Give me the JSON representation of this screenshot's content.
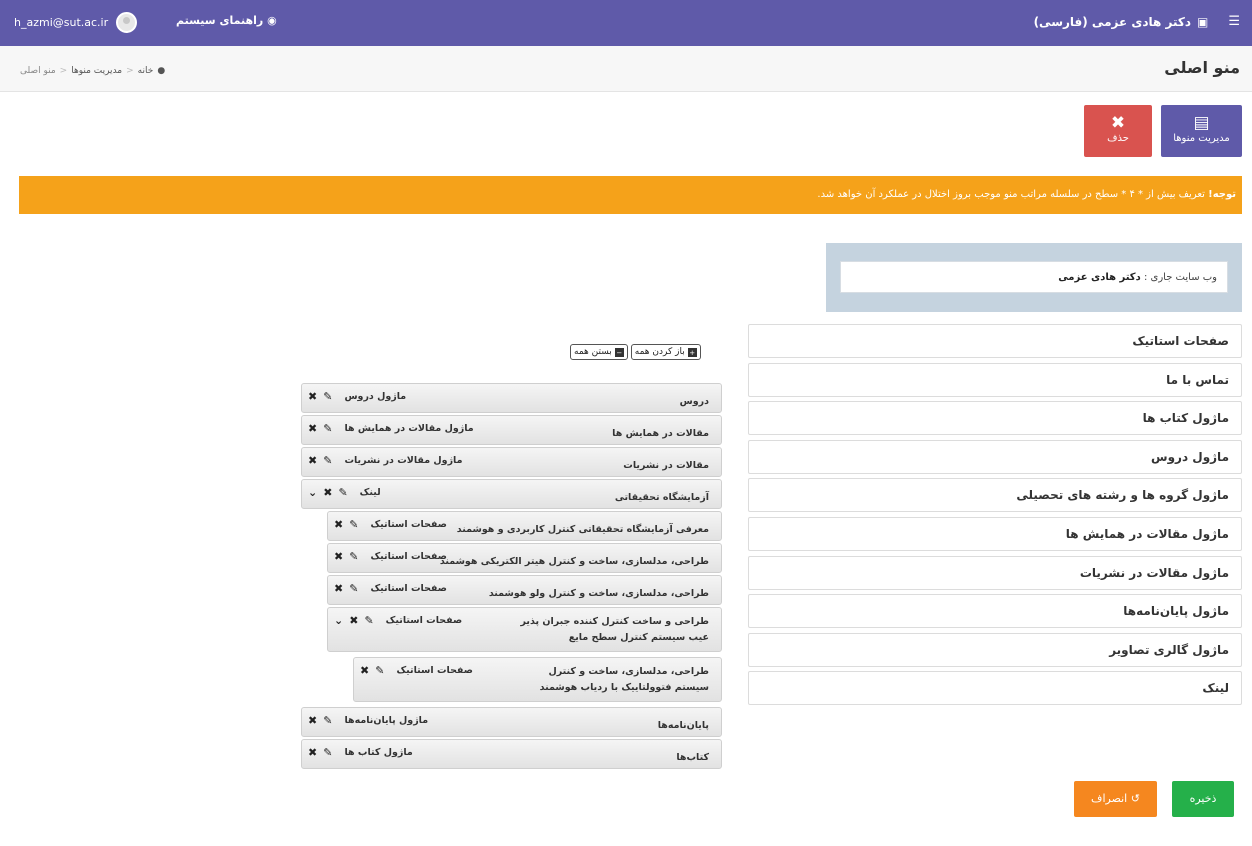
{
  "topbar": {
    "site_title": "دکتر هادی عزمی (فارسی)",
    "help_label": "راهنمای سیستم",
    "user_email": "h_azmi@sut.ac.ir"
  },
  "header": {
    "page_title": "منو اصلی",
    "breadcrumb": [
      "خانه",
      "مدیریت منوها",
      "منو اصلی"
    ]
  },
  "actions": {
    "manage_menus": "مدیریت منوها",
    "delete": "حذف"
  },
  "alert": {
    "strong": "توجه!",
    "text": "تعریف بیش از * ۴ * سطح در سلسله مراتب منو موجب بروز اختلال در عملکرد آن خواهد شد."
  },
  "website": {
    "label": "وب سایت جاری :",
    "value": "دکتر هادی عزمی"
  },
  "modules": [
    "صفحات استاتیک",
    "تماس با ما",
    "ماژول کتاب ها",
    "ماژول دروس",
    "ماژول گروه ها و رشته های تحصیلی",
    "ماژول مقالات در همایش ها",
    "ماژول مقالات در نشریات",
    "ماژول پایان‌نامه‌ها",
    "ماژول گالری تصاویر",
    "لینک"
  ],
  "tree_controls": {
    "expand_all": "باز کردن همه",
    "collapse_all": "بستن همه"
  },
  "tree": [
    {
      "title": "دروس",
      "type": "ماژول دروس",
      "level": 0
    },
    {
      "title": "مقالات در همایش ها",
      "type": "ماژول مقالات در همایش ها",
      "level": 0
    },
    {
      "title": "مقالات در نشریات",
      "type": "ماژول مقالات در نشریات",
      "level": 0
    },
    {
      "title": "آزمایشگاه تحقیقاتی",
      "type": "لینک",
      "level": 0,
      "expanded": true
    },
    {
      "title": "معرفی آزمایشگاه تحقیقاتی کنترل کاربردی و هوشمند",
      "type": "صفحات استاتیک",
      "level": 1
    },
    {
      "title": "طراحی، مدلسازی، ساخت و کنترل هیتر الکتریکی هوشمند",
      "type": "صفحات استاتیک",
      "level": 1
    },
    {
      "title": "طراحی، مدلسازی، ساخت و کنترل ولو هوشمند",
      "type": "صفحات استاتیک",
      "level": 1
    },
    {
      "title": "طراحی و ساخت کنترل کننده جبران پذیر عیب سیستم کنترل سطح مایع",
      "type": "صفحات استاتیک",
      "level": 1,
      "expanded": true
    },
    {
      "title": "طراحی، مدلسازی، ساخت و کنترل سیستم فتوولتاییک با ردیاب هوشمند",
      "type": "صفحات استاتیک",
      "level": 2
    },
    {
      "title": "پایان‌نامه‌ها",
      "type": "ماژول پایان‌نامه‌ها",
      "level": 0
    },
    {
      "title": "کتاب‌ها",
      "type": "ماژول کتاب ها",
      "level": 0
    }
  ],
  "footer": {
    "save": "ذخیره",
    "cancel": "انصراف"
  },
  "colors": {
    "topbar": "#5f5aa9",
    "delete": "#d9534f",
    "alert": "#f5a21a",
    "save": "#25b04a",
    "cancel": "#f5871f"
  }
}
